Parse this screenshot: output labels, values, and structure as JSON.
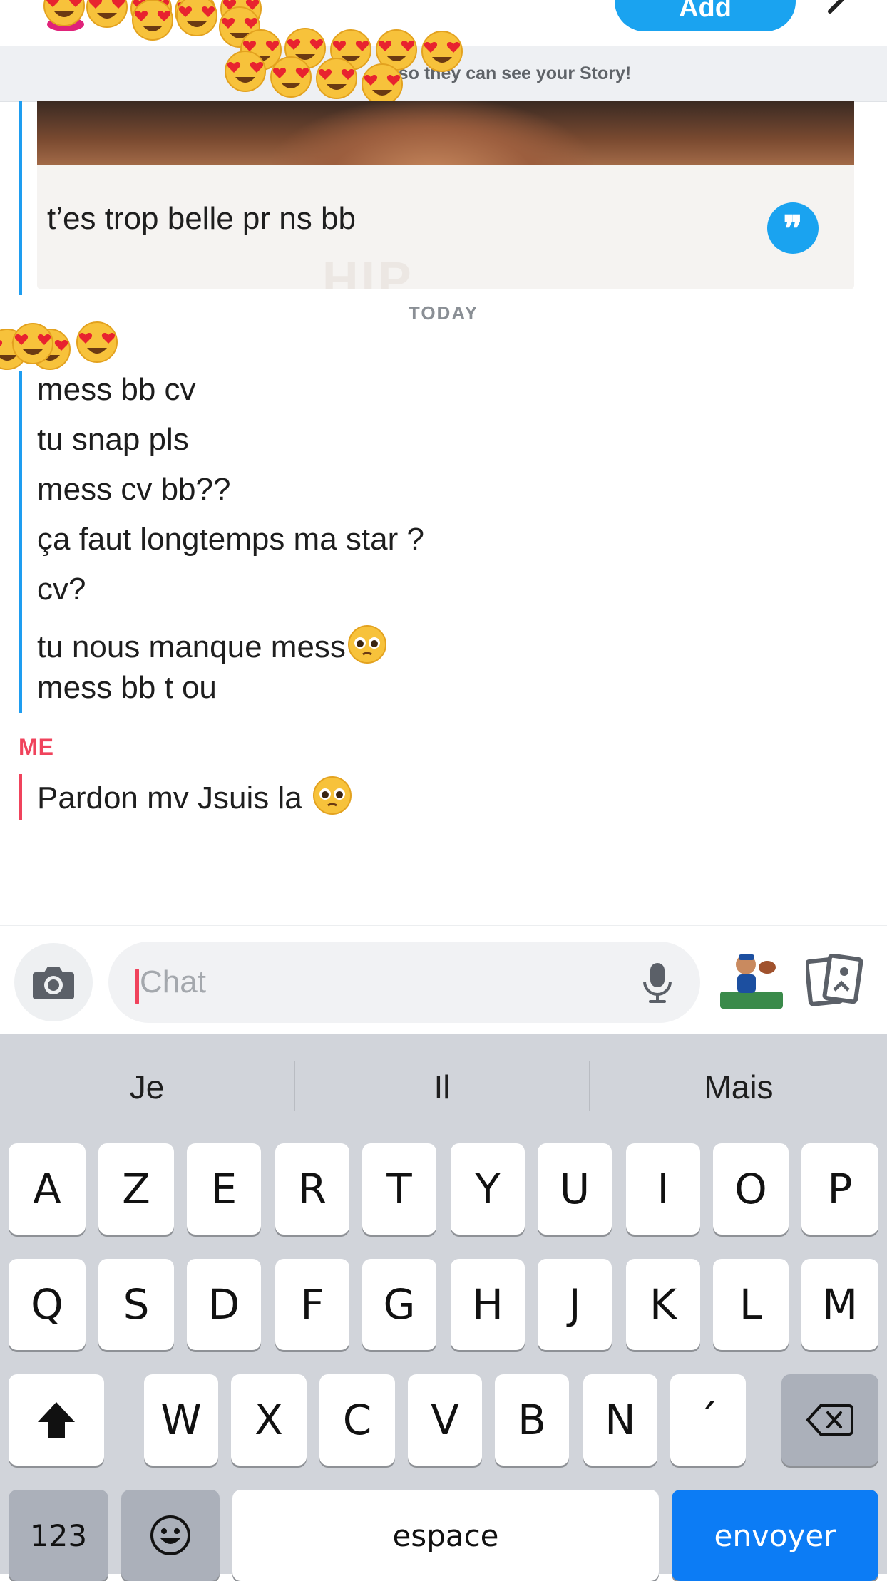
{
  "header": {
    "add_label": "Add",
    "story_banner": "so they can see your Story!"
  },
  "quoted_snap": {
    "text": "t’es trop belle pr ns bb",
    "ghost_text": "HIP"
  },
  "date_separator": "TODAY",
  "friend_messages": [
    "mess bb cv",
    "tu snap pls",
    "mess cv bb??",
    "ça faut longtemps ma star ?",
    "cv?",
    "tu nous manque mess",
    "mess bb t ou"
  ],
  "me": {
    "label": "ME",
    "message": "Pardon mv Jsuis la"
  },
  "chat_input": {
    "placeholder": "Chat"
  },
  "colors": {
    "friend_accent": "#1e9df0",
    "me_accent": "#f0435c",
    "send_key": "#0c7cf5"
  },
  "keyboard": {
    "suggestions": [
      "Je",
      "Il",
      "Mais"
    ],
    "row1": [
      "A",
      "Z",
      "E",
      "R",
      "T",
      "Y",
      "U",
      "I",
      "O",
      "P"
    ],
    "row2": [
      "Q",
      "S",
      "D",
      "F",
      "G",
      "H",
      "J",
      "K",
      "L",
      "M"
    ],
    "row3": [
      "W",
      "X",
      "C",
      "V",
      "B",
      "N",
      "´"
    ],
    "numbers_label": "123",
    "space_label": "espace",
    "send_label": "envoyer"
  }
}
